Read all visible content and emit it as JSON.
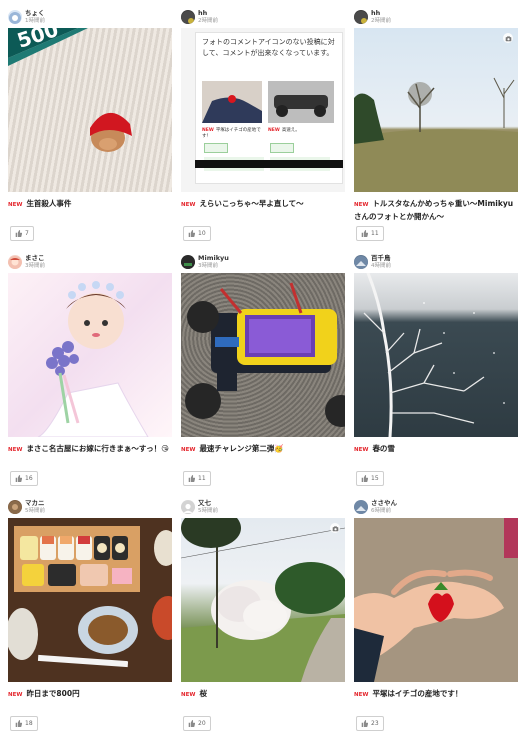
{
  "posts": [
    {
      "user": "ちょく",
      "time": "1時間前",
      "new_badge": "NEW",
      "title": "生首殺人事件",
      "likes": "7"
    },
    {
      "user": "hh",
      "time": "2時間前",
      "new_badge": "NEW",
      "title": "えらいこっちゃ〜早よ直して〜",
      "likes": "10",
      "screenshot": {
        "message": "フォトのコメントアイコンのない投稿に対して、コメントが出来なくなっています。",
        "mini_title_1": "平塚はイチゴの産地です！",
        "mini_title_2": "高速え。"
      }
    },
    {
      "user": "hh",
      "time": "2時間前",
      "new_badge": "NEW",
      "title": "トルスタなんかめっちゃ重い〜Mimikyuさんのフォトとか開かん〜",
      "likes": "11"
    },
    {
      "user": "まさこ",
      "time": "3時間前",
      "new_badge": "NEW",
      "title": "まさこ名古屋にお嫁に行きまぁ〜すっ！😘",
      "likes": "16"
    },
    {
      "user": "Mimikyu",
      "time": "3時間前",
      "new_badge": "NEW",
      "title": "最速チャレンジ第二弾🥳",
      "likes": "11"
    },
    {
      "user": "百千鳥",
      "time": "4時間前",
      "new_badge": "NEW",
      "title": "春の雪",
      "likes": "15"
    },
    {
      "user": "マカニ",
      "time": "5時間前",
      "new_badge": "NEW",
      "title": "昨日まで800円",
      "likes": "18"
    },
    {
      "user": "又七",
      "time": "5時間前",
      "new_badge": "NEW",
      "title": "桜",
      "likes": "20"
    },
    {
      "user": "ささやん",
      "time": "6時間前",
      "new_badge": "NEW",
      "title": "平塚はイチゴの産地です！",
      "likes": "23"
    }
  ],
  "colors": {
    "new": "#e4262d",
    "like_icon": "#8a8a8a"
  },
  "icons": {
    "like": "thumbs-up-icon",
    "comment": "camera-icon"
  }
}
